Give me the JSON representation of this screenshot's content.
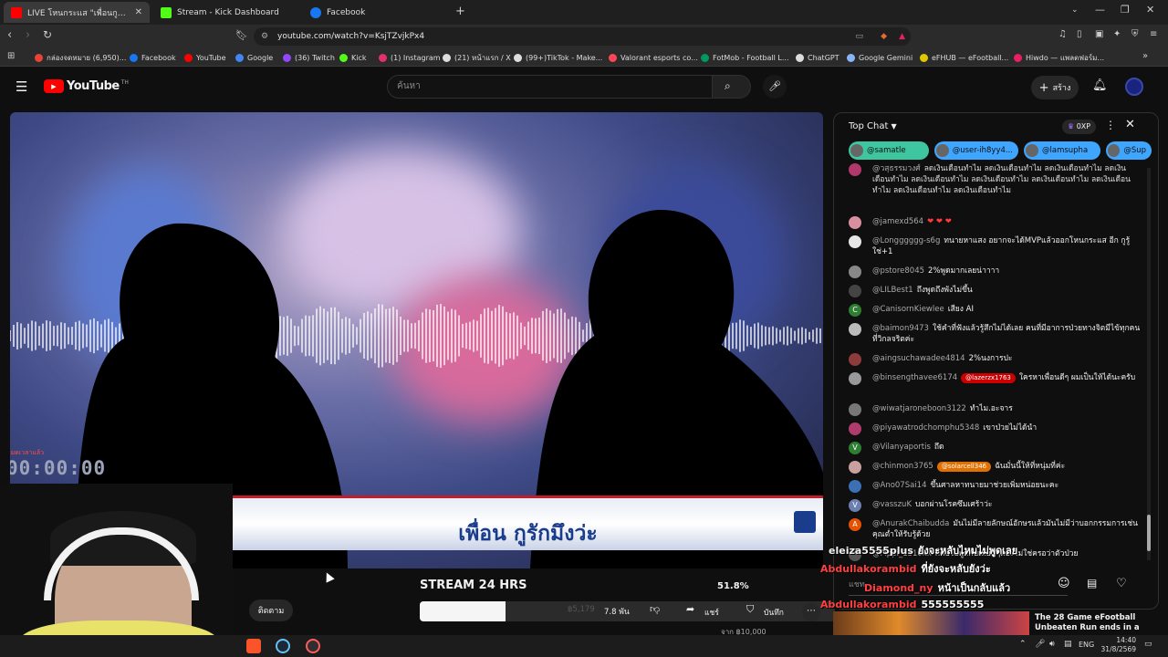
{
  "tabs": [
    {
      "title": "LIVE โหนกระแส \"เพื่อนกูรักมึงว่ะ\"",
      "color": "#ff0000"
    },
    {
      "title": "Stream - Kick Dashboard",
      "color": "#53fc18"
    },
    {
      "title": "Facebook",
      "color": "#1877f2"
    }
  ],
  "address": {
    "url": "youtube.com/watch?v=KsjTZvjkPx4"
  },
  "bookmarks": [
    {
      "label": "กล่องจดหมาย (6,950)...",
      "color": "#ea4335"
    },
    {
      "label": "Facebook",
      "color": "#1877f2"
    },
    {
      "label": "YouTube",
      "color": "#ff0000"
    },
    {
      "label": "Google",
      "color": "#4285f4"
    },
    {
      "label": "(36) Twitch",
      "color": "#9146ff"
    },
    {
      "label": "Kick",
      "color": "#53fc18"
    },
    {
      "label": "(1) Instagram",
      "color": "#e1306c"
    },
    {
      "label": "(21) หน้าแรก / X",
      "color": "#dddddd"
    },
    {
      "label": "(99+)TikTok - Make...",
      "color": "#dddddd"
    },
    {
      "label": "Valorant esports co...",
      "color": "#ff4655"
    },
    {
      "label": "FotMob - Football L...",
      "color": "#00985f"
    },
    {
      "label": "ChatGPT",
      "color": "#dddddd"
    },
    {
      "label": "Google Gemini",
      "color": "#8ab4f8"
    },
    {
      "label": "eFHUB — eFootball...",
      "color": "#e0c800"
    },
    {
      "label": "Hiwdo — แพลตฟอร์ม...",
      "color": "#e91e63"
    }
  ],
  "youtube": {
    "logo": "YouTube",
    "logo_sup": "TH",
    "search_placeholder": "ค้นหา",
    "create_label": "สร้าง"
  },
  "video": {
    "banner_text": "เพื่อน กูรักมึงว่ะ",
    "timer": "00:00:00",
    "timer_caption": "หมดเวลาแล้ว"
  },
  "below": {
    "title": "STREAM 24 HRS",
    "percent": "51.8%",
    "subscribe": "ติดตาม",
    "like_count": "7.8 พัน",
    "progress_value": "฿5,179",
    "share": "แชร์",
    "save": "บันทึก",
    "goal": "จาก ฿10,000",
    "progress_fraction": 0.518
  },
  "chat": {
    "mode": "Top Chat",
    "points": "0XP",
    "chips": [
      "@samatle",
      "@user-ih8yy4...",
      "@lamsupha",
      "@Sup"
    ],
    "messages": [
      {
        "name": "@วสุธรรมวงศ์",
        "text": "ลดเงินเดือนทำไม ลดเงินเดือนทำไม ลดเงินเดือนทำไม ลดเงินเดือนทำไม ลดเงินเดือนทำไม ลดเงินเดือนทำไม ลดเงินเดือนทำไม ลดเงินเดือนทำไม ลดเงินเดือนทำไม ลดเงินเดือนทำไม",
        "av": "#b0386a",
        "pill": "",
        "pillColor": ""
      },
      {
        "name": "@jamexd564",
        "text": "",
        "av": "#d98fa0",
        "pill": "",
        "pillColor": "",
        "hearts": "❤ ❤ ❤"
      },
      {
        "name": "@Longggggg-s6g",
        "text": "ทนายหาแสง อยากจะได้MVPแล้วออกโหนกระแส อีก กูรู้ใช่+1",
        "av": "#e6e6e6",
        "pill": "",
        "pillColor": ""
      },
      {
        "name": "@pstore8045",
        "text": "2%พูดมากเลยน่าาาา",
        "av": "#888888",
        "pill": "",
        "pillColor": ""
      },
      {
        "name": "@LILBest1",
        "text": "ถึงพูดถึงพังไม่ขึ้น",
        "av": "#444444",
        "pill": "",
        "pillColor": ""
      },
      {
        "name": "@CanisornKiewlee",
        "text": "เสียง AI",
        "av": "#2e7d32",
        "pill": "",
        "pillColor": "",
        "letter": "C"
      },
      {
        "name": "@baimon9473",
        "text": "ใช้คำที่ฟังแล้วรู้สึกไม่ได้เลย คนที่มีอาการป่วยทางจิตมีไข้ทุกคนที่วิกลจริตค่ะ",
        "av": "#bbbbbb",
        "pill": "",
        "pillColor": ""
      },
      {
        "name": "@aingsuchawadee4814",
        "text": "2%นงการปะ",
        "av": "#8d3b3b",
        "pill": "",
        "pillColor": ""
      },
      {
        "name": "@binsengthavee6174",
        "text": "ใครหาเพื่อนดีๆ ผมเป็นให้ได้นะครับ",
        "av": "#999999",
        "pill": "@lazerzx1763",
        "pillColor": "#cc0000"
      },
      {
        "name": "@wiwatjaroneboon3122",
        "text": "ทำไม.อะจาร",
        "av": "#777777",
        "pill": "",
        "pillColor": ""
      },
      {
        "name": "@piyawatrodchomphu5348",
        "text": "เขาป่วยไม่ได้นำ",
        "av": "#b03c6e",
        "pill": "",
        "pillColor": ""
      },
      {
        "name": "@Vilanyaportis",
        "text": "ถึด",
        "av": "#2e7d32",
        "pill": "",
        "pillColor": "",
        "letter": "V"
      },
      {
        "name": "@chinmon3765",
        "text": "ฉันมั่นนี้ให้ที่หนุ่มที่ค่ะ",
        "av": "#c9a0a0",
        "pill": "@solarcell346",
        "pillColor": "#e07000"
      },
      {
        "name": "@Ano07Sai14",
        "text": "ขึ้นศาลหาทนายมาช่วยเพิ่มหน่อยนะคะ",
        "av": "#3d6fb5",
        "pill": "",
        "pillColor": ""
      },
      {
        "name": "@vasszuK",
        "text": "บอกผ่านโรคซึมเศร้าว่ะ",
        "av": "#6b7fb0",
        "pill": "",
        "pillColor": "",
        "letter": "V"
      },
      {
        "name": "@AnurakChaibudda",
        "text": "มันไม่มีลายลักษณ์อักษรแล้วมันไม่มีว่าบอกกรรมการเช่นคุณต่ำให้รับรู้ด้วย",
        "av": "#e65100",
        "pill": "",
        "pillColor": "",
        "letter": "A"
      },
      {
        "name": "@Pippi_1310xx",
        "text": "ก็คือไปพูดกับเพื่อนๆดีอะไม่ใช่ครอว่าตัวป่วย",
        "av": "#555555",
        "pill": "",
        "pillColor": ""
      }
    ],
    "input_placeholder": "แชท",
    "promo_title": "The 28 Game eFootball Unbeaten Run ends in a"
  },
  "overlays": [
    {
      "name": "eleiza5555plus",
      "text": "ยังจะหลับไหมไม่พูดเลย",
      "nameColor": "#f1f1f1"
    },
    {
      "name": "Abdullakorambid",
      "text": "ที่ยังจะหลับยังว่ะ",
      "nameColor": "#ff4040"
    },
    {
      "name": "Diamond_ny",
      "text": "หน้าเป็นกลับแล้ว",
      "nameColor": "#ff4040"
    },
    {
      "name": "Abdullakorambid",
      "text": "555555555",
      "nameColor": "#ff4040"
    }
  ],
  "taskbar": {
    "lang": "ENG",
    "time": "14:40",
    "date": "31/8/2569"
  },
  "colors": {
    "accent": "#ff0000",
    "chip": "#3ea6ff"
  }
}
